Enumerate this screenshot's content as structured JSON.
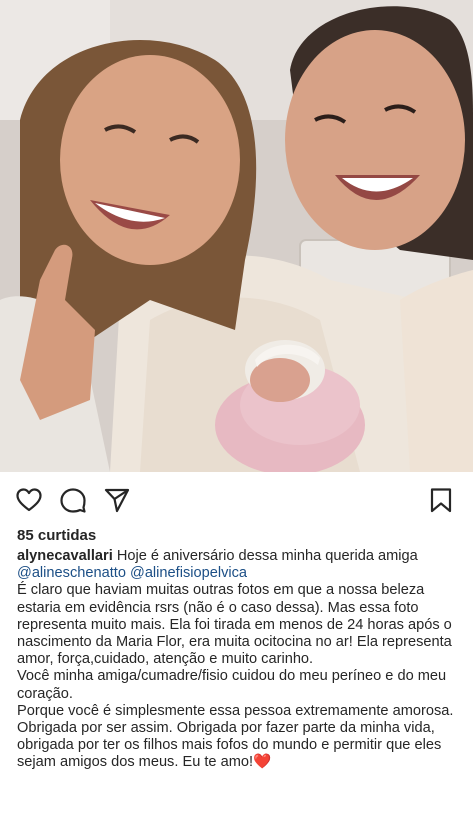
{
  "post": {
    "likes": "85 curtidas",
    "caption": {
      "username": "alynecavallari",
      "intro": "Hoje é aniversário dessa minha querida amiga",
      "mentions": [
        "@alineschenatto",
        "@alinefisiopelvica"
      ],
      "paragraphs": [
        "É claro que haviam muitas outras fotos em que a nossa beleza estaria em evidência rsrs (não é o caso dessa). Mas essa foto representa muito mais. Ela foi tirada em menos de 24 horas após o nascimento da Maria Flor, era muita ocitocina no ar! Ela representa amor, força,cuidado, atenção e muito carinho.",
        "Você minha amiga/cumadre/fisio cuidou do meu períneo e do meu coração.",
        "Porque você é simplesmente essa pessoa extremamente amorosa. Obrigada por ser assim. Obrigada por fazer parte da minha vida, obrigada por ter os filhos mais fofos do mundo e permitir que eles sejam amigos dos meus. Eu te amo!"
      ],
      "end_heart": "❤️"
    }
  },
  "actions": {
    "like_icon": "heart-outline-icon",
    "comment_icon": "comment-bubble-icon",
    "share_icon": "paper-plane-icon",
    "save_icon": "bookmark-icon"
  },
  "colors": {
    "text": "#262626",
    "mention": "#1c4f86",
    "heart": "#e1306c",
    "background": "#ffffff"
  }
}
